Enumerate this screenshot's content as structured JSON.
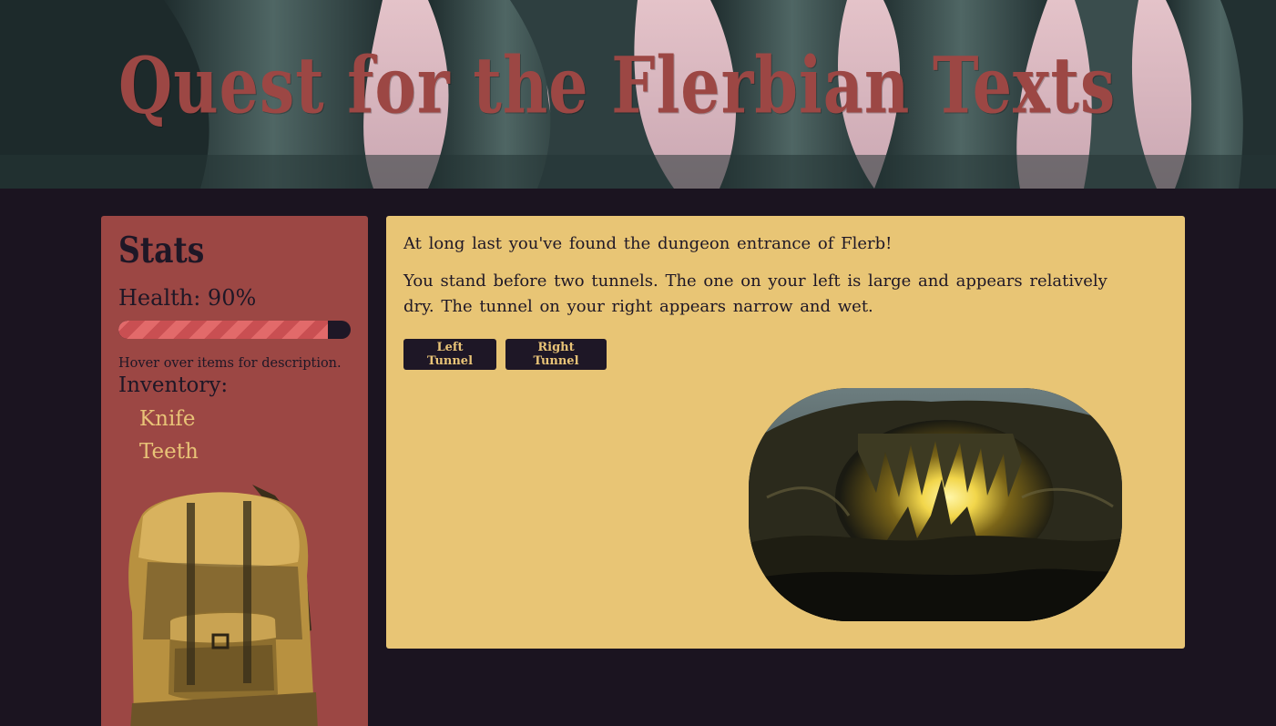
{
  "header": {
    "title": "Quest for the Flerbian Texts"
  },
  "stats": {
    "heading": "Stats",
    "health_label": "Health: 90%",
    "health_fraction": 0.9,
    "hover_hint": "Hover over items for description.",
    "inventory_label": "Inventory:",
    "inventory": [
      "Knife",
      "Teeth"
    ]
  },
  "story": {
    "intro": "At long last you've found the dungeon entrance of Flerb!",
    "body": "You stand before two tunnels. The one on your left is large and appears relatively dry. The tunnel on your right appears narrow and wet.",
    "choices": [
      "Left Tunnel",
      "Right Tunnel"
    ]
  },
  "colors": {
    "page_background": "#1b1420",
    "title": "#9c4744",
    "stats_panel": "#9c4744",
    "story_panel": "#e8c575",
    "button": "#1e1726",
    "button_text": "#e8c377",
    "health_fill": "#e26a6a"
  }
}
